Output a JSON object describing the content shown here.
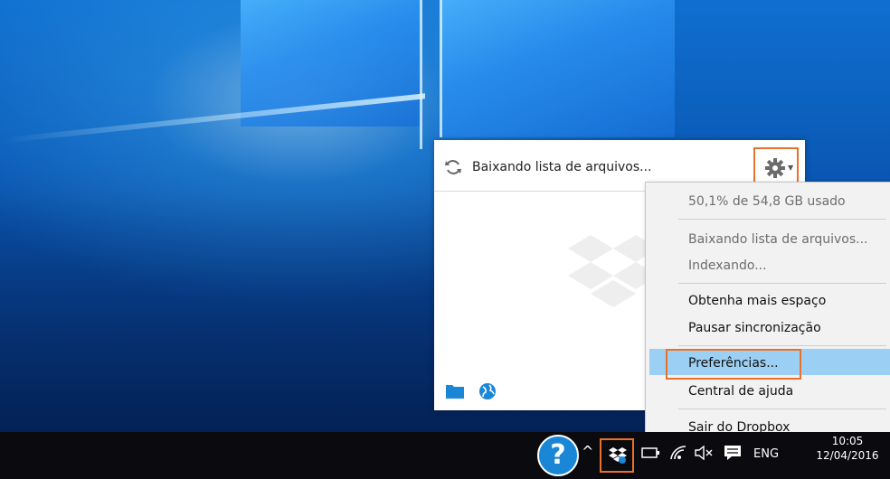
{
  "dropbox_panel": {
    "status_text": "Baixando lista de arquivos..."
  },
  "settings_menu": {
    "usage": "50,1% de 54,8 GB usado",
    "downloading": "Baixando lista de arquivos...",
    "indexing": "Indexando...",
    "get_space": "Obtenha mais espaço",
    "pause_sync": "Pausar sincronização",
    "preferences": "Preferências...",
    "help_center": "Central de ajuda",
    "quit": "Sair do Dropbox"
  },
  "taskbar": {
    "help_glyph": "?",
    "chevron": "^",
    "language": "ENG",
    "time": "10:05",
    "date": "12/04/2016"
  },
  "icons": [
    "sync-icon",
    "gear-icon",
    "dropbox-logo",
    "folder-icon",
    "globe-icon",
    "help-icon",
    "dropbox-tray-icon",
    "wifi-icon",
    "mute-icon",
    "notification-icon"
  ],
  "colors": {
    "highlight_border": "#e8722c",
    "menu_selection": "#9ccff4",
    "dropbox_blue": "#1a86d6"
  }
}
